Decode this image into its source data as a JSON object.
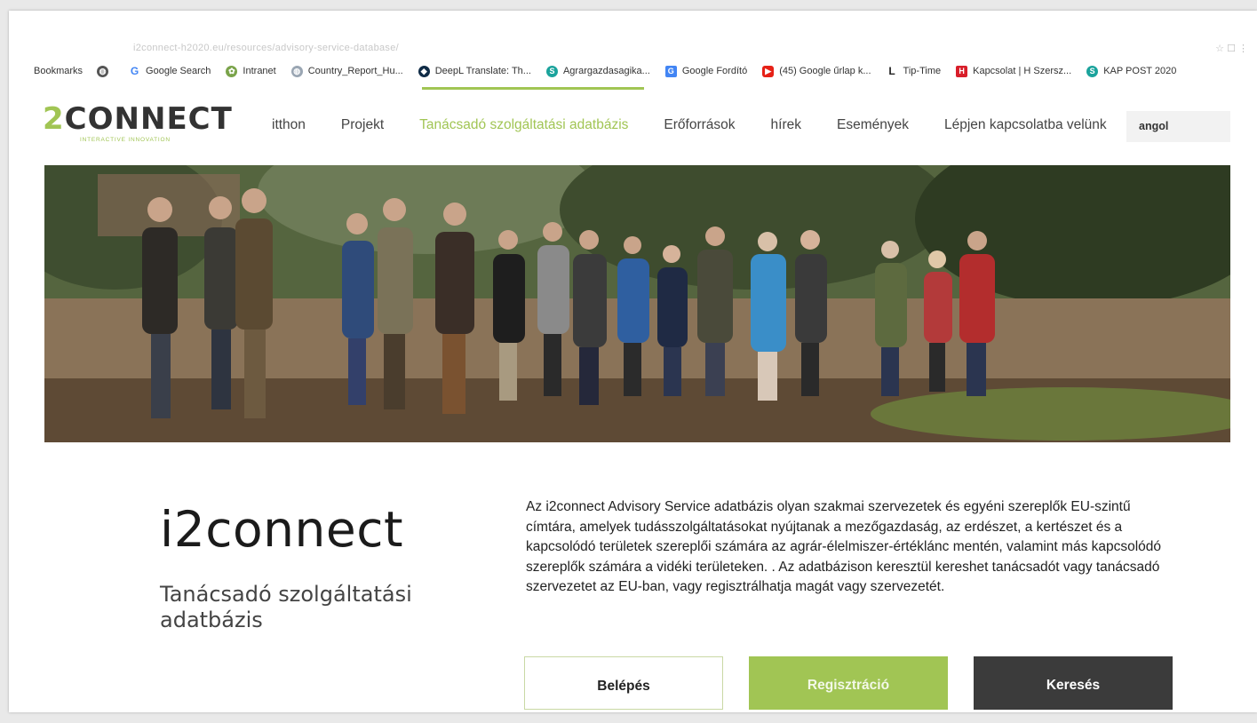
{
  "browser": {
    "address_text": "i2connect-h2020.eu/resources/advisory-service-database/",
    "bookmarks": [
      {
        "label": "Bookmarks",
        "icon": "none"
      },
      {
        "label": "",
        "icon": "globe-icon"
      },
      {
        "label": "Google Search",
        "icon": "google-icon"
      },
      {
        "label": "Intranet",
        "icon": "intranet-icon"
      },
      {
        "label": "Country_Report_Hu...",
        "icon": "globe-icon"
      },
      {
        "label": "DeepL Translate: Th...",
        "icon": "deepl-icon"
      },
      {
        "label": "Agrargazdasagika...",
        "icon": "sheet-icon"
      },
      {
        "label": "Google Fordító",
        "icon": "google-translate-icon"
      },
      {
        "label": "(45) Google űrlap k...",
        "icon": "youtube-icon"
      },
      {
        "label": "Tip-Time",
        "icon": "tiptime-icon"
      },
      {
        "label": "Kapcsolat | H Szersz...",
        "icon": "hszersz-icon"
      },
      {
        "label": "KAP POST 2020",
        "icon": "sheet-icon"
      }
    ]
  },
  "header": {
    "logo_text": "2CONNECT",
    "logo_tagline": "INTERACTIVE INNOVATION",
    "nav": [
      {
        "label": "itthon",
        "active": false
      },
      {
        "label": "Projekt",
        "active": false
      },
      {
        "label": "Tanácsadó szolgáltatási adatbázis",
        "active": true
      },
      {
        "label": "Erőforrások",
        "active": false
      },
      {
        "label": "hírek",
        "active": false
      },
      {
        "label": "Események",
        "active": false
      },
      {
        "label": "Lépjen kapcsolatba velünk",
        "active": false
      }
    ],
    "language": "angol"
  },
  "hero": {
    "image_alt": "Group of people standing in a harvested field"
  },
  "main": {
    "title": "i2connect",
    "subtitle": "Tanácsadó szolgáltatási adatbázis",
    "description": "Az i2connect Advisory Service adatbázis olyan szakmai szervezetek és egyéni szereplők EU-szintű címtára, amelyek tudásszolgáltatásokat nyújtanak a mezőgazdaság, az erdészet, a kertészet és a kapcsolódó területek szereplői számára az agrár-élelmiszer-értéklánc mentén, valamint más kapcsolódó szereplők számára a vidéki területeken. . Az adatbázison keresztül kereshet tanácsadót vagy tanácsadó szervezetet az EU-ban, vagy regisztrálhatja magát vagy szervezetét.",
    "buttons": {
      "login": "Belépés",
      "register": "Regisztráció",
      "search": "Keresés"
    }
  },
  "colors": {
    "accent": "#a1c554",
    "dark_button": "#3b3b3b",
    "text": "#222222"
  }
}
